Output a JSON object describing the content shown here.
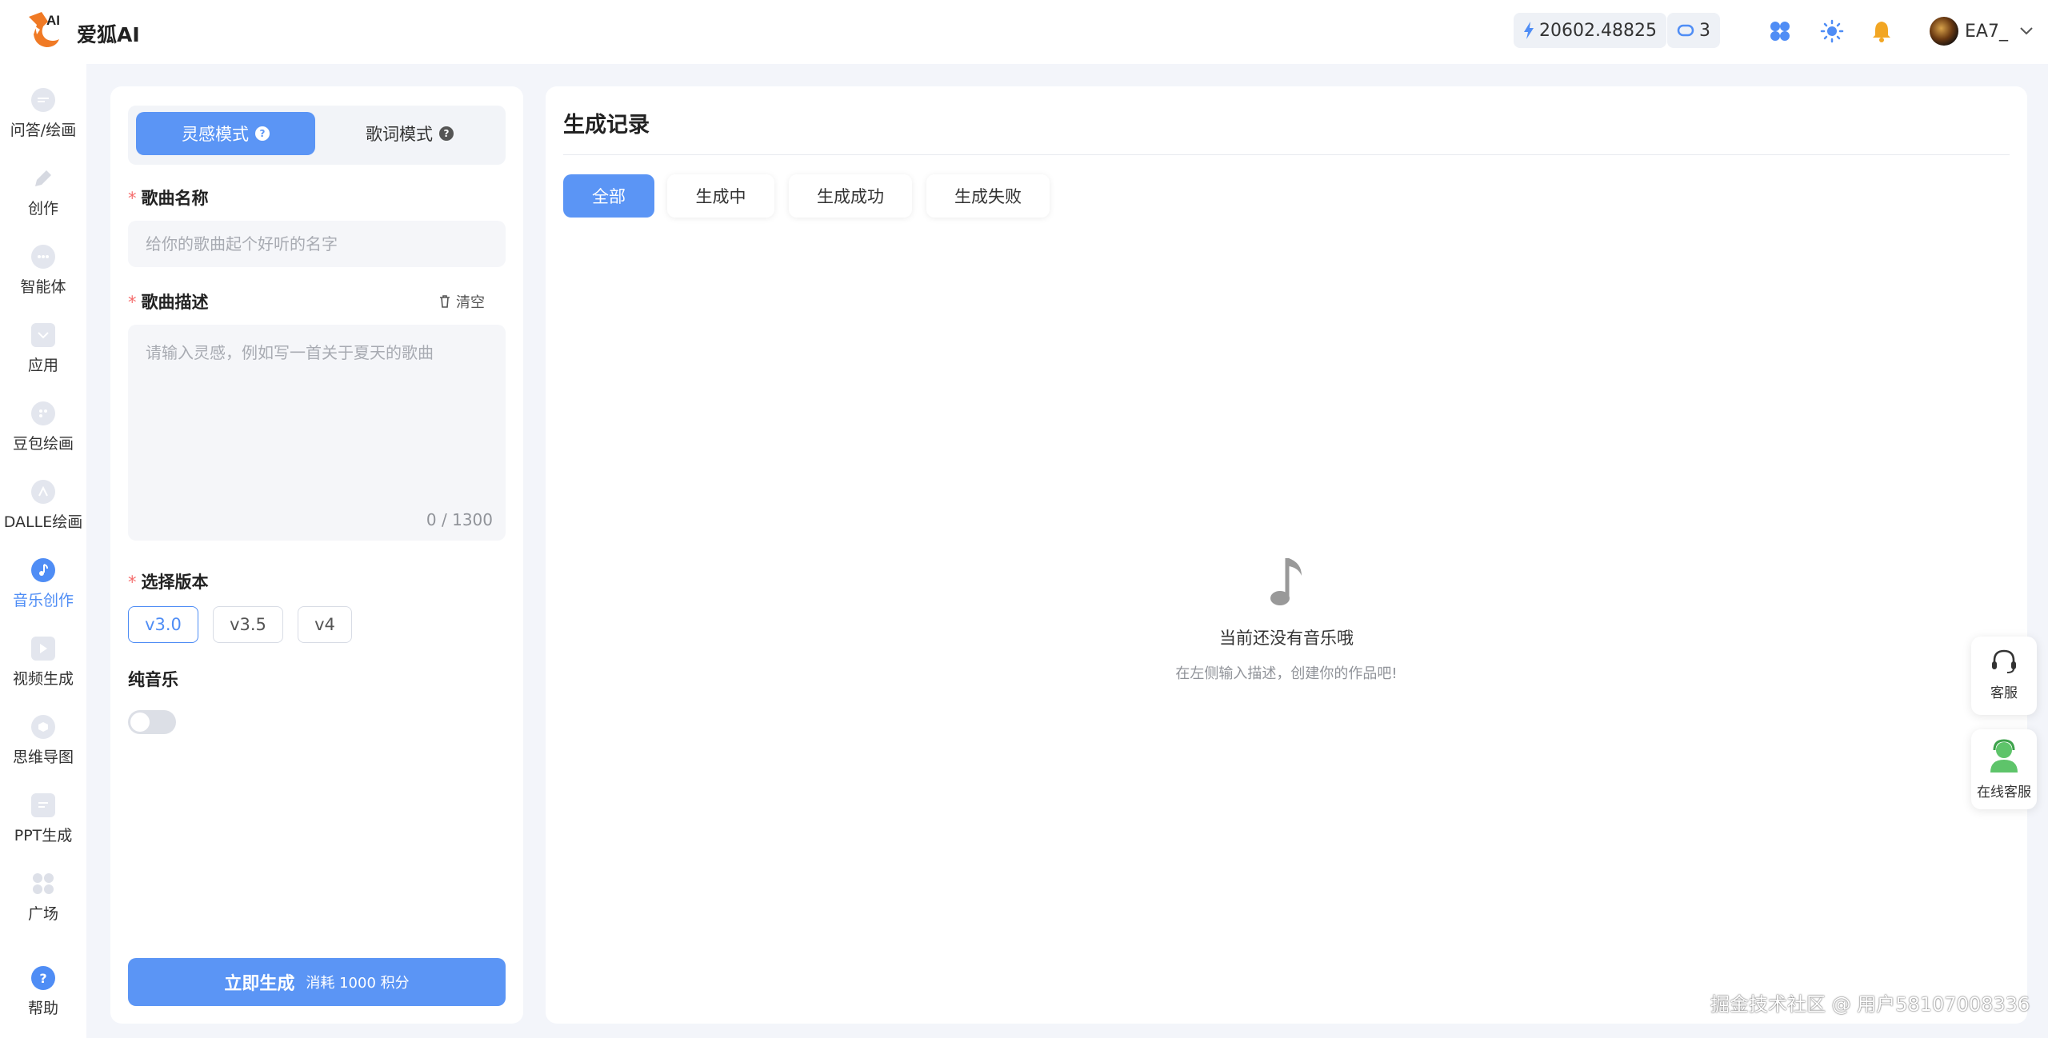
{
  "app": {
    "name": "爱狐AI"
  },
  "header": {
    "balance": "20602.48825",
    "tokens": "3",
    "user": "EA7_"
  },
  "nav": {
    "items": [
      {
        "label": "问答/绘画",
        "icon": "chat-icon"
      },
      {
        "label": "创作",
        "icon": "pencil-icon"
      },
      {
        "label": "智能体",
        "icon": "agent-icon"
      },
      {
        "label": "应用",
        "icon": "app-icon"
      },
      {
        "label": "豆包绘画",
        "icon": "palette-icon"
      },
      {
        "label": "DALLE绘画",
        "icon": "dalle-icon"
      },
      {
        "label": "音乐创作",
        "icon": "music-icon"
      },
      {
        "label": "视频生成",
        "icon": "video-icon"
      },
      {
        "label": "思维导图",
        "icon": "mindmap-icon"
      },
      {
        "label": "PPT生成",
        "icon": "ppt-icon"
      },
      {
        "label": "广场",
        "icon": "grid-icon"
      },
      {
        "label": "帮助",
        "icon": "help-icon"
      }
    ],
    "active": "音乐创作"
  },
  "form": {
    "mode_inspiration": "灵感模式",
    "mode_lyrics": "歌词模式",
    "song_name_label": "歌曲名称",
    "song_name_placeholder": "给你的歌曲起个好听的名字",
    "song_desc_label": "歌曲描述",
    "clear_label": "清空",
    "song_desc_placeholder": "请输入灵感，例如写一首关于夏天的歌曲",
    "counter": "0 / 1300",
    "version_label": "选择版本",
    "versions": [
      "v3.0",
      "v3.5",
      "v4"
    ],
    "selected_version": "v3.0",
    "instrumental_label": "纯音乐",
    "instrumental_on": false,
    "generate_label": "立即生成",
    "generate_cost": "消耗 1000 积分"
  },
  "records": {
    "title": "生成记录",
    "tabs": [
      "全部",
      "生成中",
      "生成成功",
      "生成失败"
    ],
    "active_tab": "全部",
    "empty_title": "当前还没有音乐哦",
    "empty_sub": "在左侧输入描述，创建你的作品吧!"
  },
  "float": {
    "service": "客服",
    "online_service": "在线客服"
  },
  "watermark": "掘金技术社区 @ 用户58107008336",
  "colors": {
    "accent": "#5b95f5",
    "required": "#f56c6c"
  }
}
